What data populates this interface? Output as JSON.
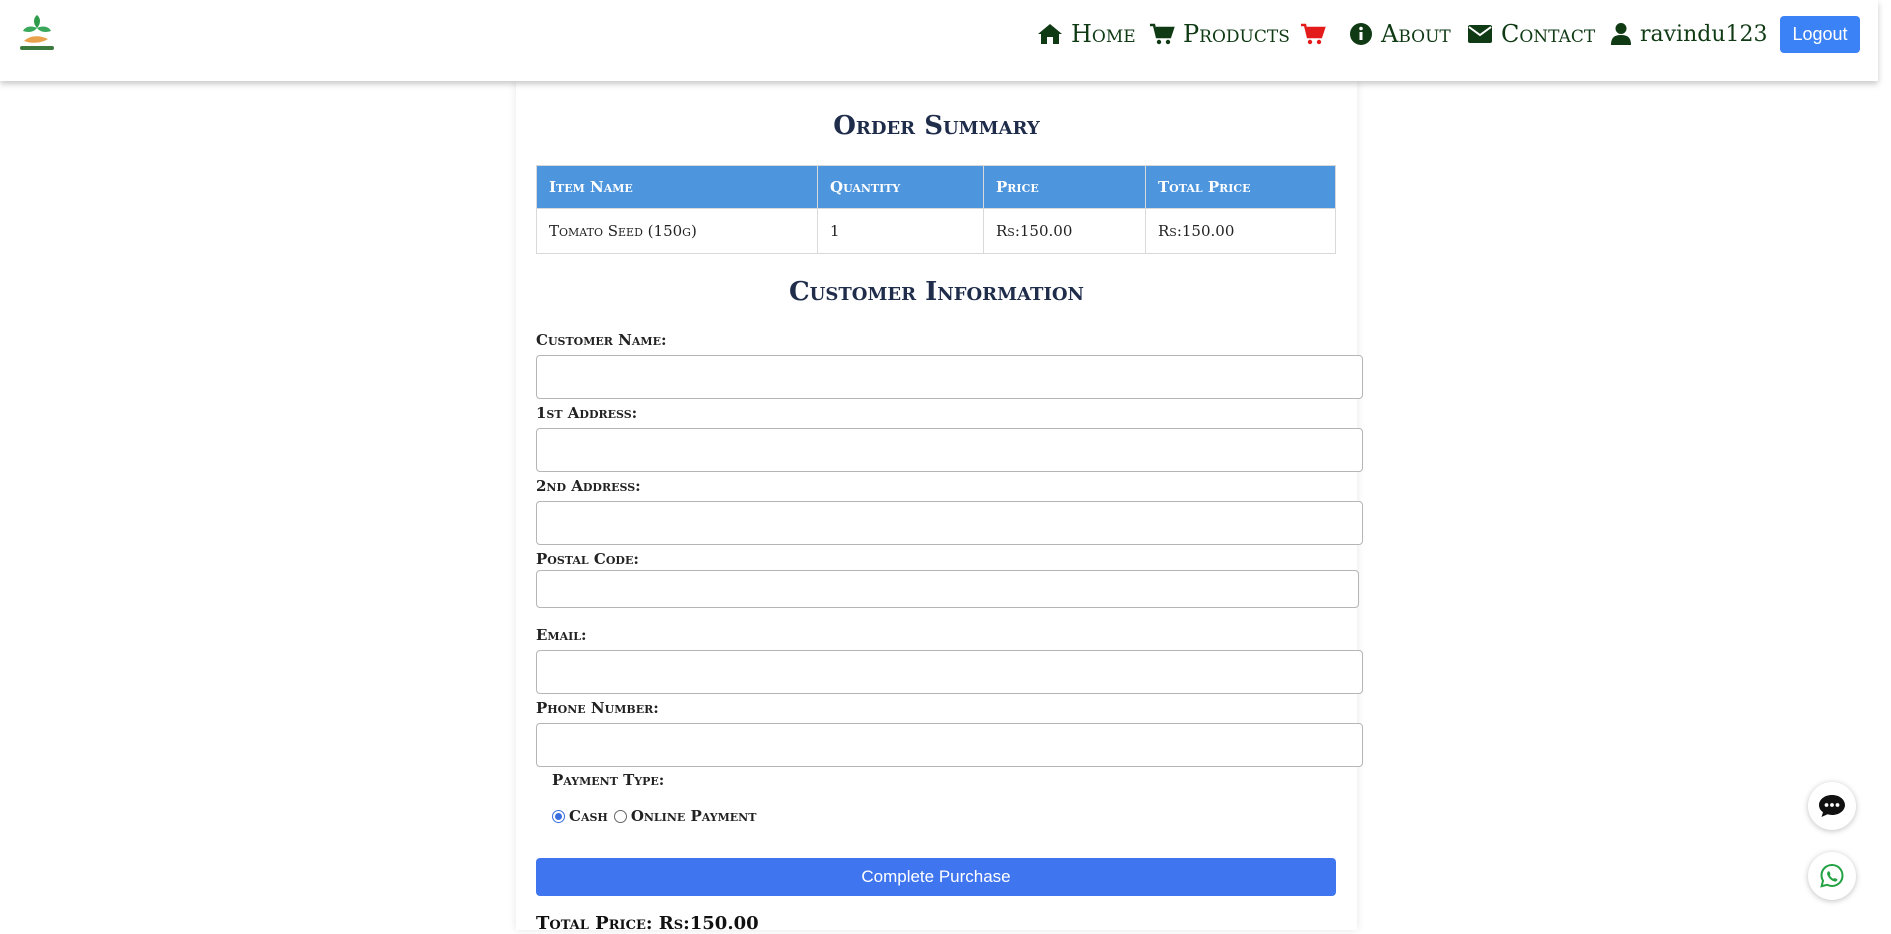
{
  "nav": {
    "items": [
      {
        "label": "Home",
        "icon": "home-icon"
      },
      {
        "label": "Products",
        "icon": "cart-icon"
      },
      {
        "label": "",
        "icon": "cart-red-icon"
      },
      {
        "label": "About",
        "icon": "info-icon"
      },
      {
        "label": "Contact",
        "icon": "envelope-icon"
      },
      {
        "label": "ravindu123",
        "icon": "user-icon"
      }
    ],
    "logout_label": "Logout",
    "cart_color": "#e31b1b"
  },
  "order_summary": {
    "title": "Order Summary",
    "columns": [
      "Item Name",
      "Quantity",
      "Price",
      "Total Price"
    ],
    "rows": [
      [
        "Tomato Seed (150g)",
        "1",
        "Rs:150.00",
        "Rs:150.00"
      ]
    ]
  },
  "customer": {
    "title": "Customer Information",
    "fields": {
      "name": {
        "label": "Customer Name:",
        "value": ""
      },
      "address1": {
        "label": "1st Address:",
        "value": ""
      },
      "address2": {
        "label": "2nd Address:",
        "value": ""
      },
      "postal": {
        "label": "Postal Code:",
        "value": ""
      },
      "email": {
        "label": "Email:",
        "value": ""
      },
      "phone": {
        "label": "Phone Number:",
        "value": ""
      }
    },
    "payment_type_label": "Payment Type:",
    "payment_options": [
      {
        "label": "Cash",
        "selected": true
      },
      {
        "label": "Online Payment",
        "selected": false
      }
    ],
    "purchase_button": "Complete Purchase",
    "total_text": "Total Price: Rs:150.00"
  },
  "floating": {
    "chat_icon": "chat-bubble-icon",
    "whatsapp_icon": "whatsapp-icon",
    "whatsapp_color": "#25a244"
  },
  "colors": {
    "nav_text": "#0f3a14",
    "table_header": "#4d95dc",
    "primary_button": "#4075f0",
    "title_text": "#1f2d4b"
  }
}
